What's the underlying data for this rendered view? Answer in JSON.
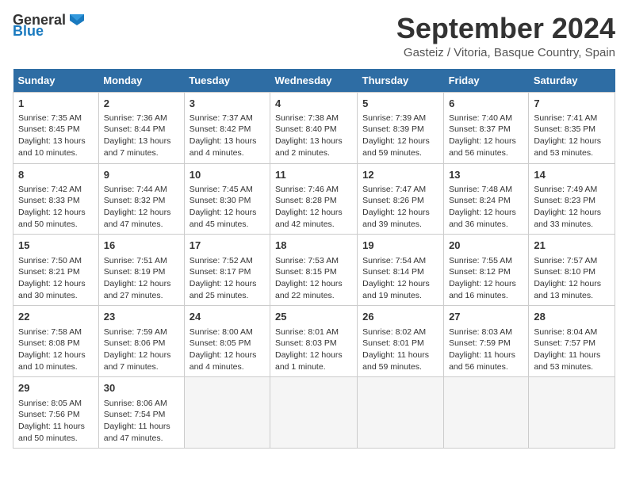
{
  "header": {
    "logo_general": "General",
    "logo_blue": "Blue",
    "month": "September 2024",
    "location": "Gasteiz / Vitoria, Basque Country, Spain"
  },
  "days_of_week": [
    "Sunday",
    "Monday",
    "Tuesday",
    "Wednesday",
    "Thursday",
    "Friday",
    "Saturday"
  ],
  "weeks": [
    [
      {
        "day": 1,
        "info": "Sunrise: 7:35 AM\nSunset: 8:45 PM\nDaylight: 13 hours and 10 minutes."
      },
      {
        "day": 2,
        "info": "Sunrise: 7:36 AM\nSunset: 8:44 PM\nDaylight: 13 hours and 7 minutes."
      },
      {
        "day": 3,
        "info": "Sunrise: 7:37 AM\nSunset: 8:42 PM\nDaylight: 13 hours and 4 minutes."
      },
      {
        "day": 4,
        "info": "Sunrise: 7:38 AM\nSunset: 8:40 PM\nDaylight: 13 hours and 2 minutes."
      },
      {
        "day": 5,
        "info": "Sunrise: 7:39 AM\nSunset: 8:39 PM\nDaylight: 12 hours and 59 minutes."
      },
      {
        "day": 6,
        "info": "Sunrise: 7:40 AM\nSunset: 8:37 PM\nDaylight: 12 hours and 56 minutes."
      },
      {
        "day": 7,
        "info": "Sunrise: 7:41 AM\nSunset: 8:35 PM\nDaylight: 12 hours and 53 minutes."
      }
    ],
    [
      {
        "day": 8,
        "info": "Sunrise: 7:42 AM\nSunset: 8:33 PM\nDaylight: 12 hours and 50 minutes."
      },
      {
        "day": 9,
        "info": "Sunrise: 7:44 AM\nSunset: 8:32 PM\nDaylight: 12 hours and 47 minutes."
      },
      {
        "day": 10,
        "info": "Sunrise: 7:45 AM\nSunset: 8:30 PM\nDaylight: 12 hours and 45 minutes."
      },
      {
        "day": 11,
        "info": "Sunrise: 7:46 AM\nSunset: 8:28 PM\nDaylight: 12 hours and 42 minutes."
      },
      {
        "day": 12,
        "info": "Sunrise: 7:47 AM\nSunset: 8:26 PM\nDaylight: 12 hours and 39 minutes."
      },
      {
        "day": 13,
        "info": "Sunrise: 7:48 AM\nSunset: 8:24 PM\nDaylight: 12 hours and 36 minutes."
      },
      {
        "day": 14,
        "info": "Sunrise: 7:49 AM\nSunset: 8:23 PM\nDaylight: 12 hours and 33 minutes."
      }
    ],
    [
      {
        "day": 15,
        "info": "Sunrise: 7:50 AM\nSunset: 8:21 PM\nDaylight: 12 hours and 30 minutes."
      },
      {
        "day": 16,
        "info": "Sunrise: 7:51 AM\nSunset: 8:19 PM\nDaylight: 12 hours and 27 minutes."
      },
      {
        "day": 17,
        "info": "Sunrise: 7:52 AM\nSunset: 8:17 PM\nDaylight: 12 hours and 25 minutes."
      },
      {
        "day": 18,
        "info": "Sunrise: 7:53 AM\nSunset: 8:15 PM\nDaylight: 12 hours and 22 minutes."
      },
      {
        "day": 19,
        "info": "Sunrise: 7:54 AM\nSunset: 8:14 PM\nDaylight: 12 hours and 19 minutes."
      },
      {
        "day": 20,
        "info": "Sunrise: 7:55 AM\nSunset: 8:12 PM\nDaylight: 12 hours and 16 minutes."
      },
      {
        "day": 21,
        "info": "Sunrise: 7:57 AM\nSunset: 8:10 PM\nDaylight: 12 hours and 13 minutes."
      }
    ],
    [
      {
        "day": 22,
        "info": "Sunrise: 7:58 AM\nSunset: 8:08 PM\nDaylight: 12 hours and 10 minutes."
      },
      {
        "day": 23,
        "info": "Sunrise: 7:59 AM\nSunset: 8:06 PM\nDaylight: 12 hours and 7 minutes."
      },
      {
        "day": 24,
        "info": "Sunrise: 8:00 AM\nSunset: 8:05 PM\nDaylight: 12 hours and 4 minutes."
      },
      {
        "day": 25,
        "info": "Sunrise: 8:01 AM\nSunset: 8:03 PM\nDaylight: 12 hours and 1 minute."
      },
      {
        "day": 26,
        "info": "Sunrise: 8:02 AM\nSunset: 8:01 PM\nDaylight: 11 hours and 59 minutes."
      },
      {
        "day": 27,
        "info": "Sunrise: 8:03 AM\nSunset: 7:59 PM\nDaylight: 11 hours and 56 minutes."
      },
      {
        "day": 28,
        "info": "Sunrise: 8:04 AM\nSunset: 7:57 PM\nDaylight: 11 hours and 53 minutes."
      }
    ],
    [
      {
        "day": 29,
        "info": "Sunrise: 8:05 AM\nSunset: 7:56 PM\nDaylight: 11 hours and 50 minutes."
      },
      {
        "day": 30,
        "info": "Sunrise: 8:06 AM\nSunset: 7:54 PM\nDaylight: 11 hours and 47 minutes."
      },
      null,
      null,
      null,
      null,
      null
    ]
  ]
}
